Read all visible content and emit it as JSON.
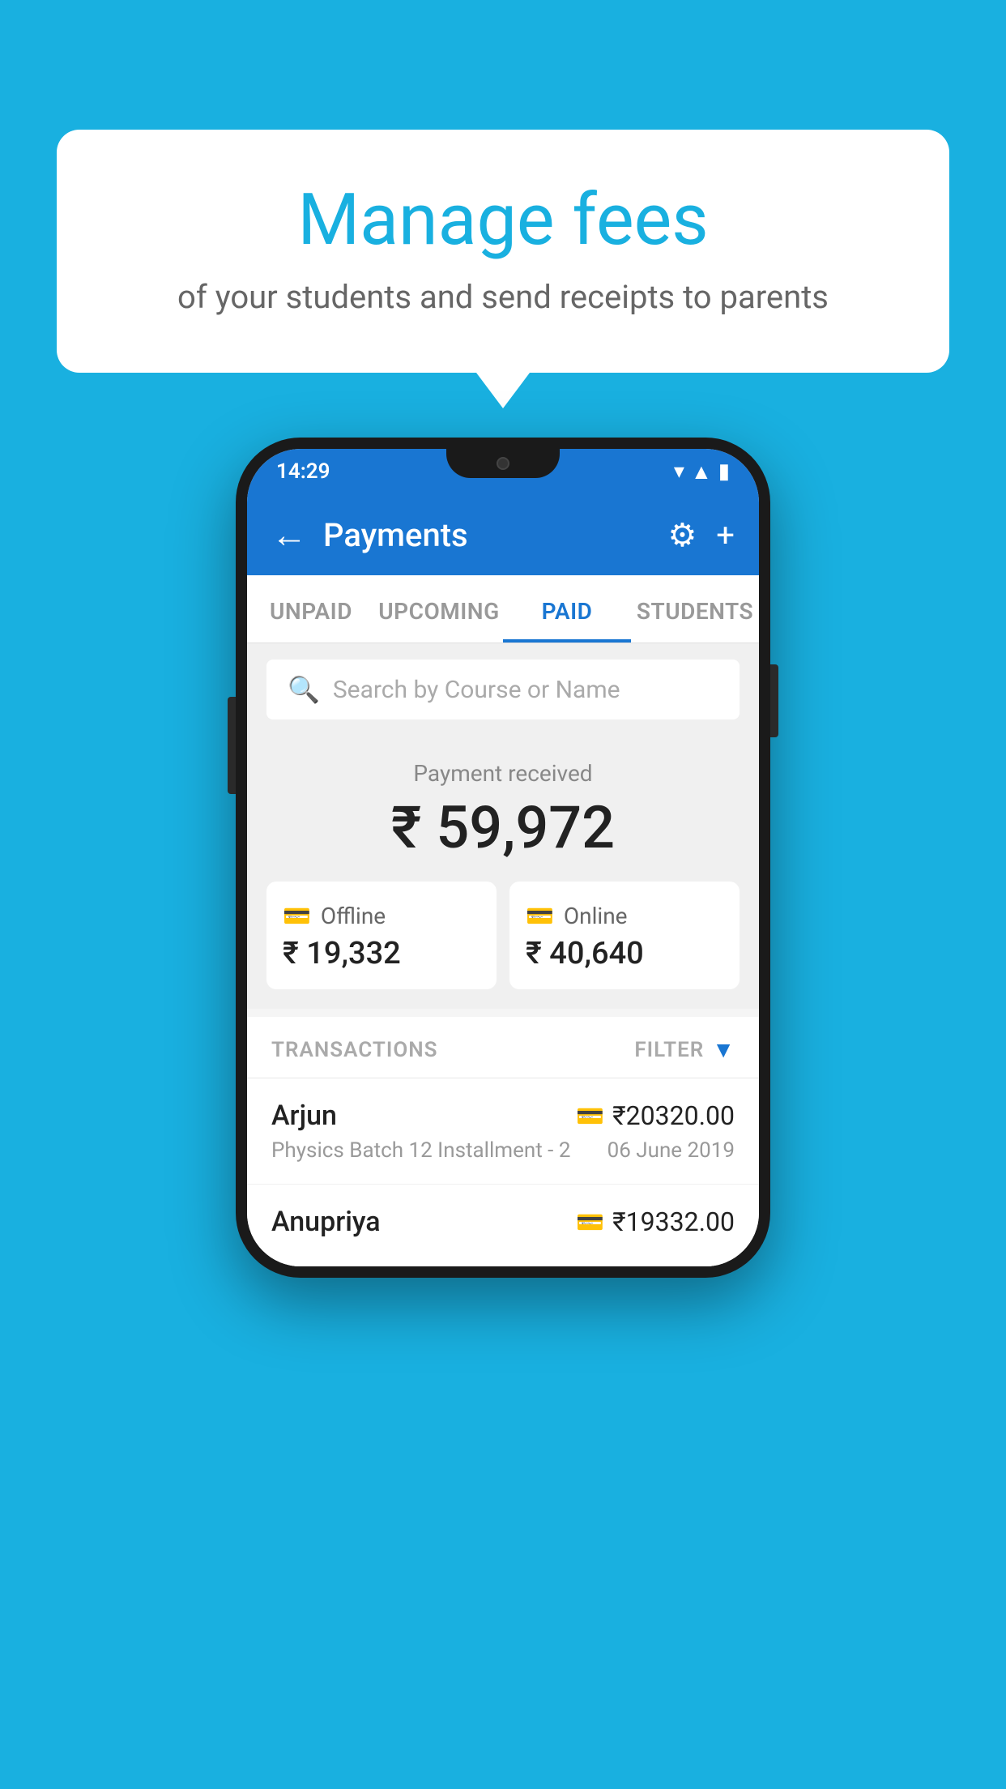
{
  "background_color": "#19b0e0",
  "speech_bubble": {
    "title": "Manage fees",
    "subtitle": "of your students and send receipts to parents"
  },
  "status_bar": {
    "time": "14:29",
    "wifi": "wifi",
    "signal": "signal",
    "battery": "battery"
  },
  "app_bar": {
    "back_icon": "←",
    "title": "Payments",
    "gear_icon": "⚙",
    "plus_icon": "+"
  },
  "tabs": [
    {
      "label": "UNPAID",
      "active": false
    },
    {
      "label": "UPCOMING",
      "active": false
    },
    {
      "label": "PAID",
      "active": true
    },
    {
      "label": "STUDENTS",
      "active": false
    }
  ],
  "search": {
    "placeholder": "Search by Course or Name",
    "icon": "🔍"
  },
  "payment_section": {
    "label": "Payment received",
    "total_amount": "₹ 59,972",
    "offline": {
      "icon": "💳",
      "label": "Offline",
      "amount": "₹ 19,332"
    },
    "online": {
      "icon": "💳",
      "label": "Online",
      "amount": "₹ 40,640"
    }
  },
  "transactions": {
    "header_label": "TRANSACTIONS",
    "filter_label": "FILTER",
    "rows": [
      {
        "name": "Arjun",
        "amount": "₹20320.00",
        "course": "Physics Batch 12 Installment - 2",
        "date": "06 June 2019",
        "payment_type": "online"
      },
      {
        "name": "Anupriya",
        "amount": "₹19332.00",
        "course": "",
        "date": "",
        "payment_type": "offline"
      }
    ]
  }
}
